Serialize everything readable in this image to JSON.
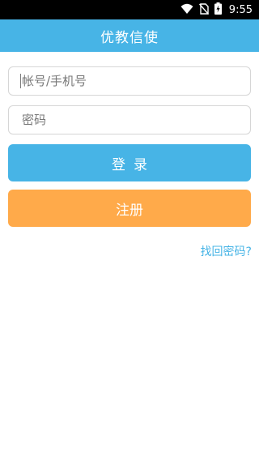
{
  "status_bar": {
    "time": "9:55",
    "icons": [
      "wifi-icon",
      "no-sim-icon",
      "battery-charging-icon"
    ]
  },
  "header": {
    "title": "优教信使"
  },
  "form": {
    "account_placeholder": "帐号/手机号",
    "account_value": "",
    "password_placeholder": "密码",
    "password_value": "",
    "login_label": "登录",
    "register_label": "注册",
    "forgot_label": "找回密码?"
  },
  "colors": {
    "primary": "#47B4E6",
    "register": "#FFAA4A",
    "status_bar": "#000000"
  }
}
